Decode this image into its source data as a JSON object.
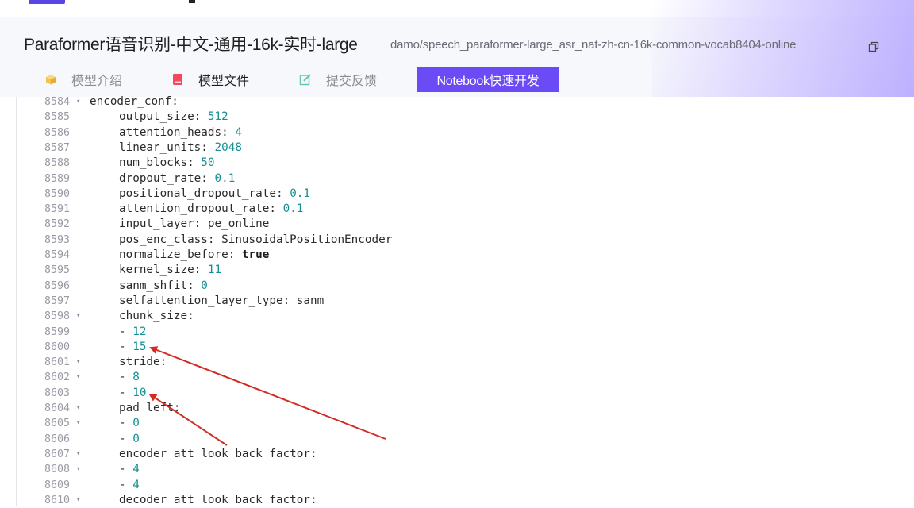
{
  "header": {
    "title": "Paraformer语音识别-中文-通用-16k-实时-large",
    "model_id": "damo/speech_paraformer-large_asr_nat-zh-cn-16k-common-vocab8404-online",
    "copy_icon": "copy-icon"
  },
  "tabs": [
    {
      "label": "模型介绍",
      "icon": "cube-icon",
      "icon_color": "#f5c24d",
      "active": false
    },
    {
      "label": "模型文件",
      "icon": "book-icon",
      "icon_color": "#f04a5b",
      "active": true
    },
    {
      "label": "提交反馈",
      "icon": "edit-icon",
      "icon_color": "#63c8b8",
      "active": false
    }
  ],
  "notebook_button": {
    "label": "Notebook快速开发",
    "color": "#6a4bf5"
  },
  "code_lines": [
    {
      "ln": "8584",
      "fold": true,
      "indent": 0,
      "key": "encoder_conf:",
      "value": "",
      "type": ""
    },
    {
      "ln": "8585",
      "fold": false,
      "indent": 1,
      "key": "output_size: ",
      "value": "512",
      "type": "num"
    },
    {
      "ln": "8586",
      "fold": false,
      "indent": 1,
      "key": "attention_heads: ",
      "value": "4",
      "type": "num"
    },
    {
      "ln": "8587",
      "fold": false,
      "indent": 1,
      "key": "linear_units: ",
      "value": "2048",
      "type": "num"
    },
    {
      "ln": "8588",
      "fold": false,
      "indent": 1,
      "key": "num_blocks: ",
      "value": "50",
      "type": "num"
    },
    {
      "ln": "8589",
      "fold": false,
      "indent": 1,
      "key": "dropout_rate: ",
      "value": "0.1",
      "type": "num"
    },
    {
      "ln": "8590",
      "fold": false,
      "indent": 1,
      "key": "positional_dropout_rate: ",
      "value": "0.1",
      "type": "num"
    },
    {
      "ln": "8591",
      "fold": false,
      "indent": 1,
      "key": "attention_dropout_rate: ",
      "value": "0.1",
      "type": "num"
    },
    {
      "ln": "8592",
      "fold": false,
      "indent": 1,
      "key": "input_layer: pe_online",
      "value": "",
      "type": ""
    },
    {
      "ln": "8593",
      "fold": false,
      "indent": 1,
      "key": "pos_enc_class: SinusoidalPositionEncoder",
      "value": "",
      "type": ""
    },
    {
      "ln": "8594",
      "fold": false,
      "indent": 1,
      "key": "normalize_before: ",
      "value": "true",
      "type": "kw"
    },
    {
      "ln": "8595",
      "fold": false,
      "indent": 1,
      "key": "kernel_size: ",
      "value": "11",
      "type": "num"
    },
    {
      "ln": "8596",
      "fold": false,
      "indent": 1,
      "key": "sanm_shfit: ",
      "value": "0",
      "type": "num"
    },
    {
      "ln": "8597",
      "fold": false,
      "indent": 1,
      "key": "selfattention_layer_type: sanm",
      "value": "",
      "type": ""
    },
    {
      "ln": "8598",
      "fold": true,
      "indent": 1,
      "key": "chunk_size:",
      "value": "",
      "type": ""
    },
    {
      "ln": "8599",
      "fold": false,
      "indent": 1,
      "key": "- ",
      "value": "12",
      "type": "num"
    },
    {
      "ln": "8600",
      "fold": false,
      "indent": 1,
      "key": "- ",
      "value": "15",
      "type": "num"
    },
    {
      "ln": "8601",
      "fold": true,
      "indent": 1,
      "key": "stride:",
      "value": "",
      "type": ""
    },
    {
      "ln": "8602",
      "fold": true,
      "indent": 1,
      "key": "- ",
      "value": "8",
      "type": "num"
    },
    {
      "ln": "8603",
      "fold": false,
      "indent": 1,
      "key": "- ",
      "value": "10",
      "type": "num"
    },
    {
      "ln": "8604",
      "fold": true,
      "indent": 1,
      "key": "pad_left:",
      "value": "",
      "type": ""
    },
    {
      "ln": "8605",
      "fold": true,
      "indent": 1,
      "key": "- ",
      "value": "0",
      "type": "num"
    },
    {
      "ln": "8606",
      "fold": false,
      "indent": 1,
      "key": "- ",
      "value": "0",
      "type": "num"
    },
    {
      "ln": "8607",
      "fold": true,
      "indent": 1,
      "key": "encoder_att_look_back_factor:",
      "value": "",
      "type": ""
    },
    {
      "ln": "8608",
      "fold": true,
      "indent": 1,
      "key": "- ",
      "value": "4",
      "type": "num"
    },
    {
      "ln": "8609",
      "fold": false,
      "indent": 1,
      "key": "- ",
      "value": "4",
      "type": "num"
    },
    {
      "ln": "8610",
      "fold": true,
      "indent": 1,
      "key": "decoder_att_look_back_factor:",
      "value": "",
      "type": ""
    }
  ],
  "annotation_color": "#d42b22"
}
